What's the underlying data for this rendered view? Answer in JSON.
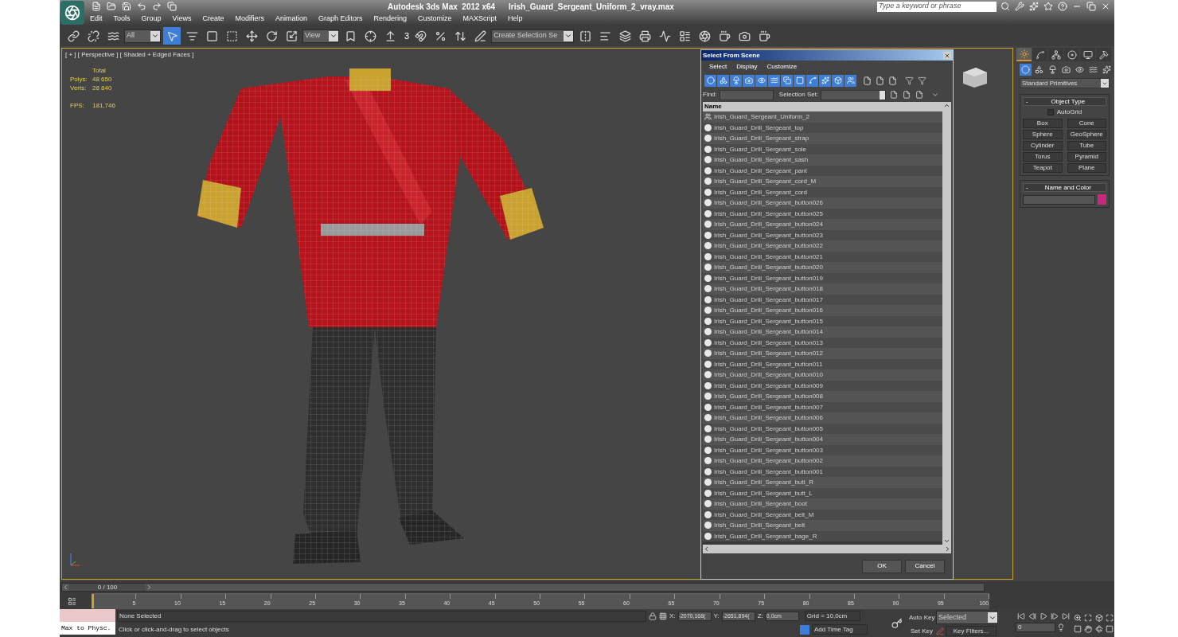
{
  "title_bar": {
    "app_title": "Autodesk 3ds Max  2012 x64",
    "file_name": "Irish_Guard_Sergeant_Uniform_2_vray.max",
    "search_placeholder": "Type a keyword or phrase"
  },
  "menu": [
    "Edit",
    "Tools",
    "Group",
    "Views",
    "Create",
    "Modifiers",
    "Animation",
    "Graph Editors",
    "Rendering",
    "Customize",
    "MAXScript",
    "Help"
  ],
  "toolbar": {
    "selection_filter": "All",
    "reference_system": "View",
    "named_selection": "Create Selection Se",
    "snap_angle": "3"
  },
  "viewport": {
    "label": "[ + ] [ Perspective ] [ Shaded + Edged Faces ]",
    "stats_header": "Total",
    "stats": [
      {
        "label": "Polys:",
        "value": "48 650"
      },
      {
        "label": "Verts:",
        "value": "28 840"
      }
    ],
    "fps": {
      "label": "FPS:",
      "value": "181,746"
    }
  },
  "dialog": {
    "title": "Select From Scene",
    "menu": [
      "Select",
      "Display",
      "Customize"
    ],
    "find_label": "Find:",
    "selection_set_label": "Selection Set:",
    "column": "Name",
    "rows": [
      {
        "name": "Irish_Guard_Sergeant_Uniform_2",
        "kind": "group"
      },
      {
        "name": "Irish_Guard_Drill_Sergeant_top",
        "kind": "object"
      },
      {
        "name": "Irish_Guard_Drill_Sergeant_strap",
        "kind": "object"
      },
      {
        "name": "Irish_Guard_Drill_Sergeant_sole",
        "kind": "object"
      },
      {
        "name": "Irish_Guard_Drill_Sergeant_sash",
        "kind": "object"
      },
      {
        "name": "Irish_Guard_Drill_Sergeant_pant",
        "kind": "object"
      },
      {
        "name": "Irish_Guard_Drill_Sergeant_cord_M",
        "kind": "object"
      },
      {
        "name": "Irish_Guard_Drill_Sergeant_cord",
        "kind": "object"
      },
      {
        "name": "Irish_Guard_Drill_Sergeant_button026",
        "kind": "object"
      },
      {
        "name": "Irish_Guard_Drill_Sergeant_button025",
        "kind": "object"
      },
      {
        "name": "Irish_Guard_Drill_Sergeant_button024",
        "kind": "object"
      },
      {
        "name": "Irish_Guard_Drill_Sergeant_button023",
        "kind": "object"
      },
      {
        "name": "Irish_Guard_Drill_Sergeant_button022",
        "kind": "object"
      },
      {
        "name": "Irish_Guard_Drill_Sergeant_button021",
        "kind": "object"
      },
      {
        "name": "Irish_Guard_Drill_Sergeant_button020",
        "kind": "object"
      },
      {
        "name": "Irish_Guard_Drill_Sergeant_button019",
        "kind": "object"
      },
      {
        "name": "Irish_Guard_Drill_Sergeant_button018",
        "kind": "object"
      },
      {
        "name": "Irish_Guard_Drill_Sergeant_button017",
        "kind": "object"
      },
      {
        "name": "Irish_Guard_Drill_Sergeant_button016",
        "kind": "object"
      },
      {
        "name": "Irish_Guard_Drill_Sergeant_button015",
        "kind": "object"
      },
      {
        "name": "Irish_Guard_Drill_Sergeant_button014",
        "kind": "object"
      },
      {
        "name": "Irish_Guard_Drill_Sergeant_button013",
        "kind": "object"
      },
      {
        "name": "Irish_Guard_Drill_Sergeant_button012",
        "kind": "object"
      },
      {
        "name": "Irish_Guard_Drill_Sergeant_button011",
        "kind": "object"
      },
      {
        "name": "Irish_Guard_Drill_Sergeant_button010",
        "kind": "object"
      },
      {
        "name": "Irish_Guard_Drill_Sergeant_button009",
        "kind": "object"
      },
      {
        "name": "Irish_Guard_Drill_Sergeant_button008",
        "kind": "object"
      },
      {
        "name": "Irish_Guard_Drill_Sergeant_button007",
        "kind": "object"
      },
      {
        "name": "Irish_Guard_Drill_Sergeant_button006",
        "kind": "object"
      },
      {
        "name": "Irish_Guard_Drill_Sergeant_button005",
        "kind": "object"
      },
      {
        "name": "Irish_Guard_Drill_Sergeant_button004",
        "kind": "object"
      },
      {
        "name": "Irish_Guard_Drill_Sergeant_button003",
        "kind": "object"
      },
      {
        "name": "Irish_Guard_Drill_Sergeant_button002",
        "kind": "object"
      },
      {
        "name": "Irish_Guard_Drill_Sergeant_button001",
        "kind": "object"
      },
      {
        "name": "Irish_Guard_Drill_Sergeant_butt_R",
        "kind": "object"
      },
      {
        "name": "Irish_Guard_Drill_Sergeant_butt_L",
        "kind": "object"
      },
      {
        "name": "Irish_Guard_Drill_Sergeant_boot",
        "kind": "object"
      },
      {
        "name": "Irish_Guard_Drill_Sergeant_belt_M",
        "kind": "object"
      },
      {
        "name": "Irish_Guard_Drill_Sergeant_belt",
        "kind": "object"
      },
      {
        "name": "Irish_Guard_Drill_Sergeant_bage_R",
        "kind": "object"
      }
    ],
    "buttons": [
      "OK",
      "Cancel"
    ]
  },
  "command_panel": {
    "tabs": [
      {
        "selected": true
      },
      {
        "selected": false
      },
      {
        "selected": false
      },
      {
        "selected": false
      },
      {
        "selected": false
      },
      {
        "selected": false
      }
    ],
    "category": "Standard Primitives",
    "object_type": {
      "toggle": "-",
      "title": "Object Type",
      "autogrid": {
        "label": "AutoGrid",
        "checked": false
      },
      "buttons": [
        "Box",
        "Cone",
        "Sphere",
        "GeoSphere",
        "Cylinder",
        "Tube",
        "Torus",
        "Pyramid",
        "Teapot",
        "Plane"
      ]
    },
    "name_and_color": {
      "toggle": "-",
      "title": "Name and Color"
    }
  },
  "timeline": {
    "position": "0 / 100",
    "level": 0,
    "ticks": [
      "5",
      "10",
      "15",
      "20",
      "25",
      "30",
      "35",
      "40",
      "45",
      "50",
      "55",
      "60",
      "65",
      "70",
      "75",
      "80",
      "85",
      "90",
      "95",
      "100"
    ]
  },
  "status_bar": {
    "listener": "Max to Physc.",
    "selection": "None Selected",
    "prompt": "Click or click-and-drag to select objects",
    "x_label": "X:",
    "x": "-2070,168(",
    "y_label": "Y:",
    "y": "-2651,894(",
    "z_label": "Z:",
    "z": "0,0cm",
    "grid": "Grid = 10,0cm",
    "add_time_tag": "Add Time Tag",
    "auto_key": "Auto Key",
    "set_key": "Set Key",
    "key_mode": "Selected",
    "key_filters": "Key Filters...",
    "frame": "0"
  }
}
